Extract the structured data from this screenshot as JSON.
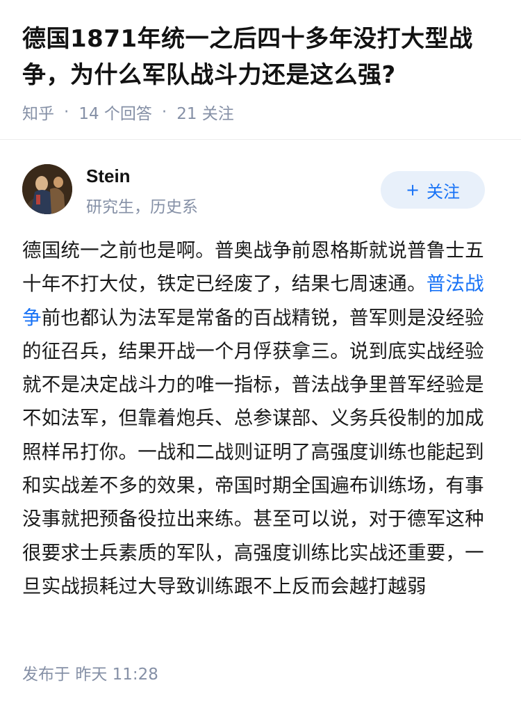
{
  "question": {
    "title": "德国1871年统一之后四十多年没打大型战争，为什么军队战斗力还是这么强?",
    "source": "知乎",
    "answers": "14 个回答",
    "followers": "21 关注"
  },
  "author": {
    "name": "Stein",
    "description": "研究生，历史系",
    "follow_label": "关注",
    "follow_icon": "+"
  },
  "answer": {
    "text_before_link": "德国统一之前也是啊。普奥战争前恩格斯就说普鲁士五十年不打大仗，铁定已经废了，结果七周速通。",
    "link_text": "普法战争",
    "text_after_link": "前也都认为法军是常备的百战精锐，普军则是没经验的征召兵，结果开战一个月俘获拿三。说到底实战经验就不是决定战斗力的唯一指标，普法战争里普军经验是不如法军，但靠着炮兵、总参谋部、义务兵役制的加成照样吊打你。一战和二战则证明了高强度训练也能起到和实战差不多的效果，帝国时期全国遍布训练场，有事没事就把预备役拉出来练。甚至可以说，对于德军这种很要求士兵素质的军队，高强度训练比实战还重要，一旦实战损耗过大导致训练跟不上反而会越打越弱",
    "link_color": "#1772f6"
  },
  "footer": {
    "published_label": "发布于",
    "published_time": "昨天 11:28"
  }
}
